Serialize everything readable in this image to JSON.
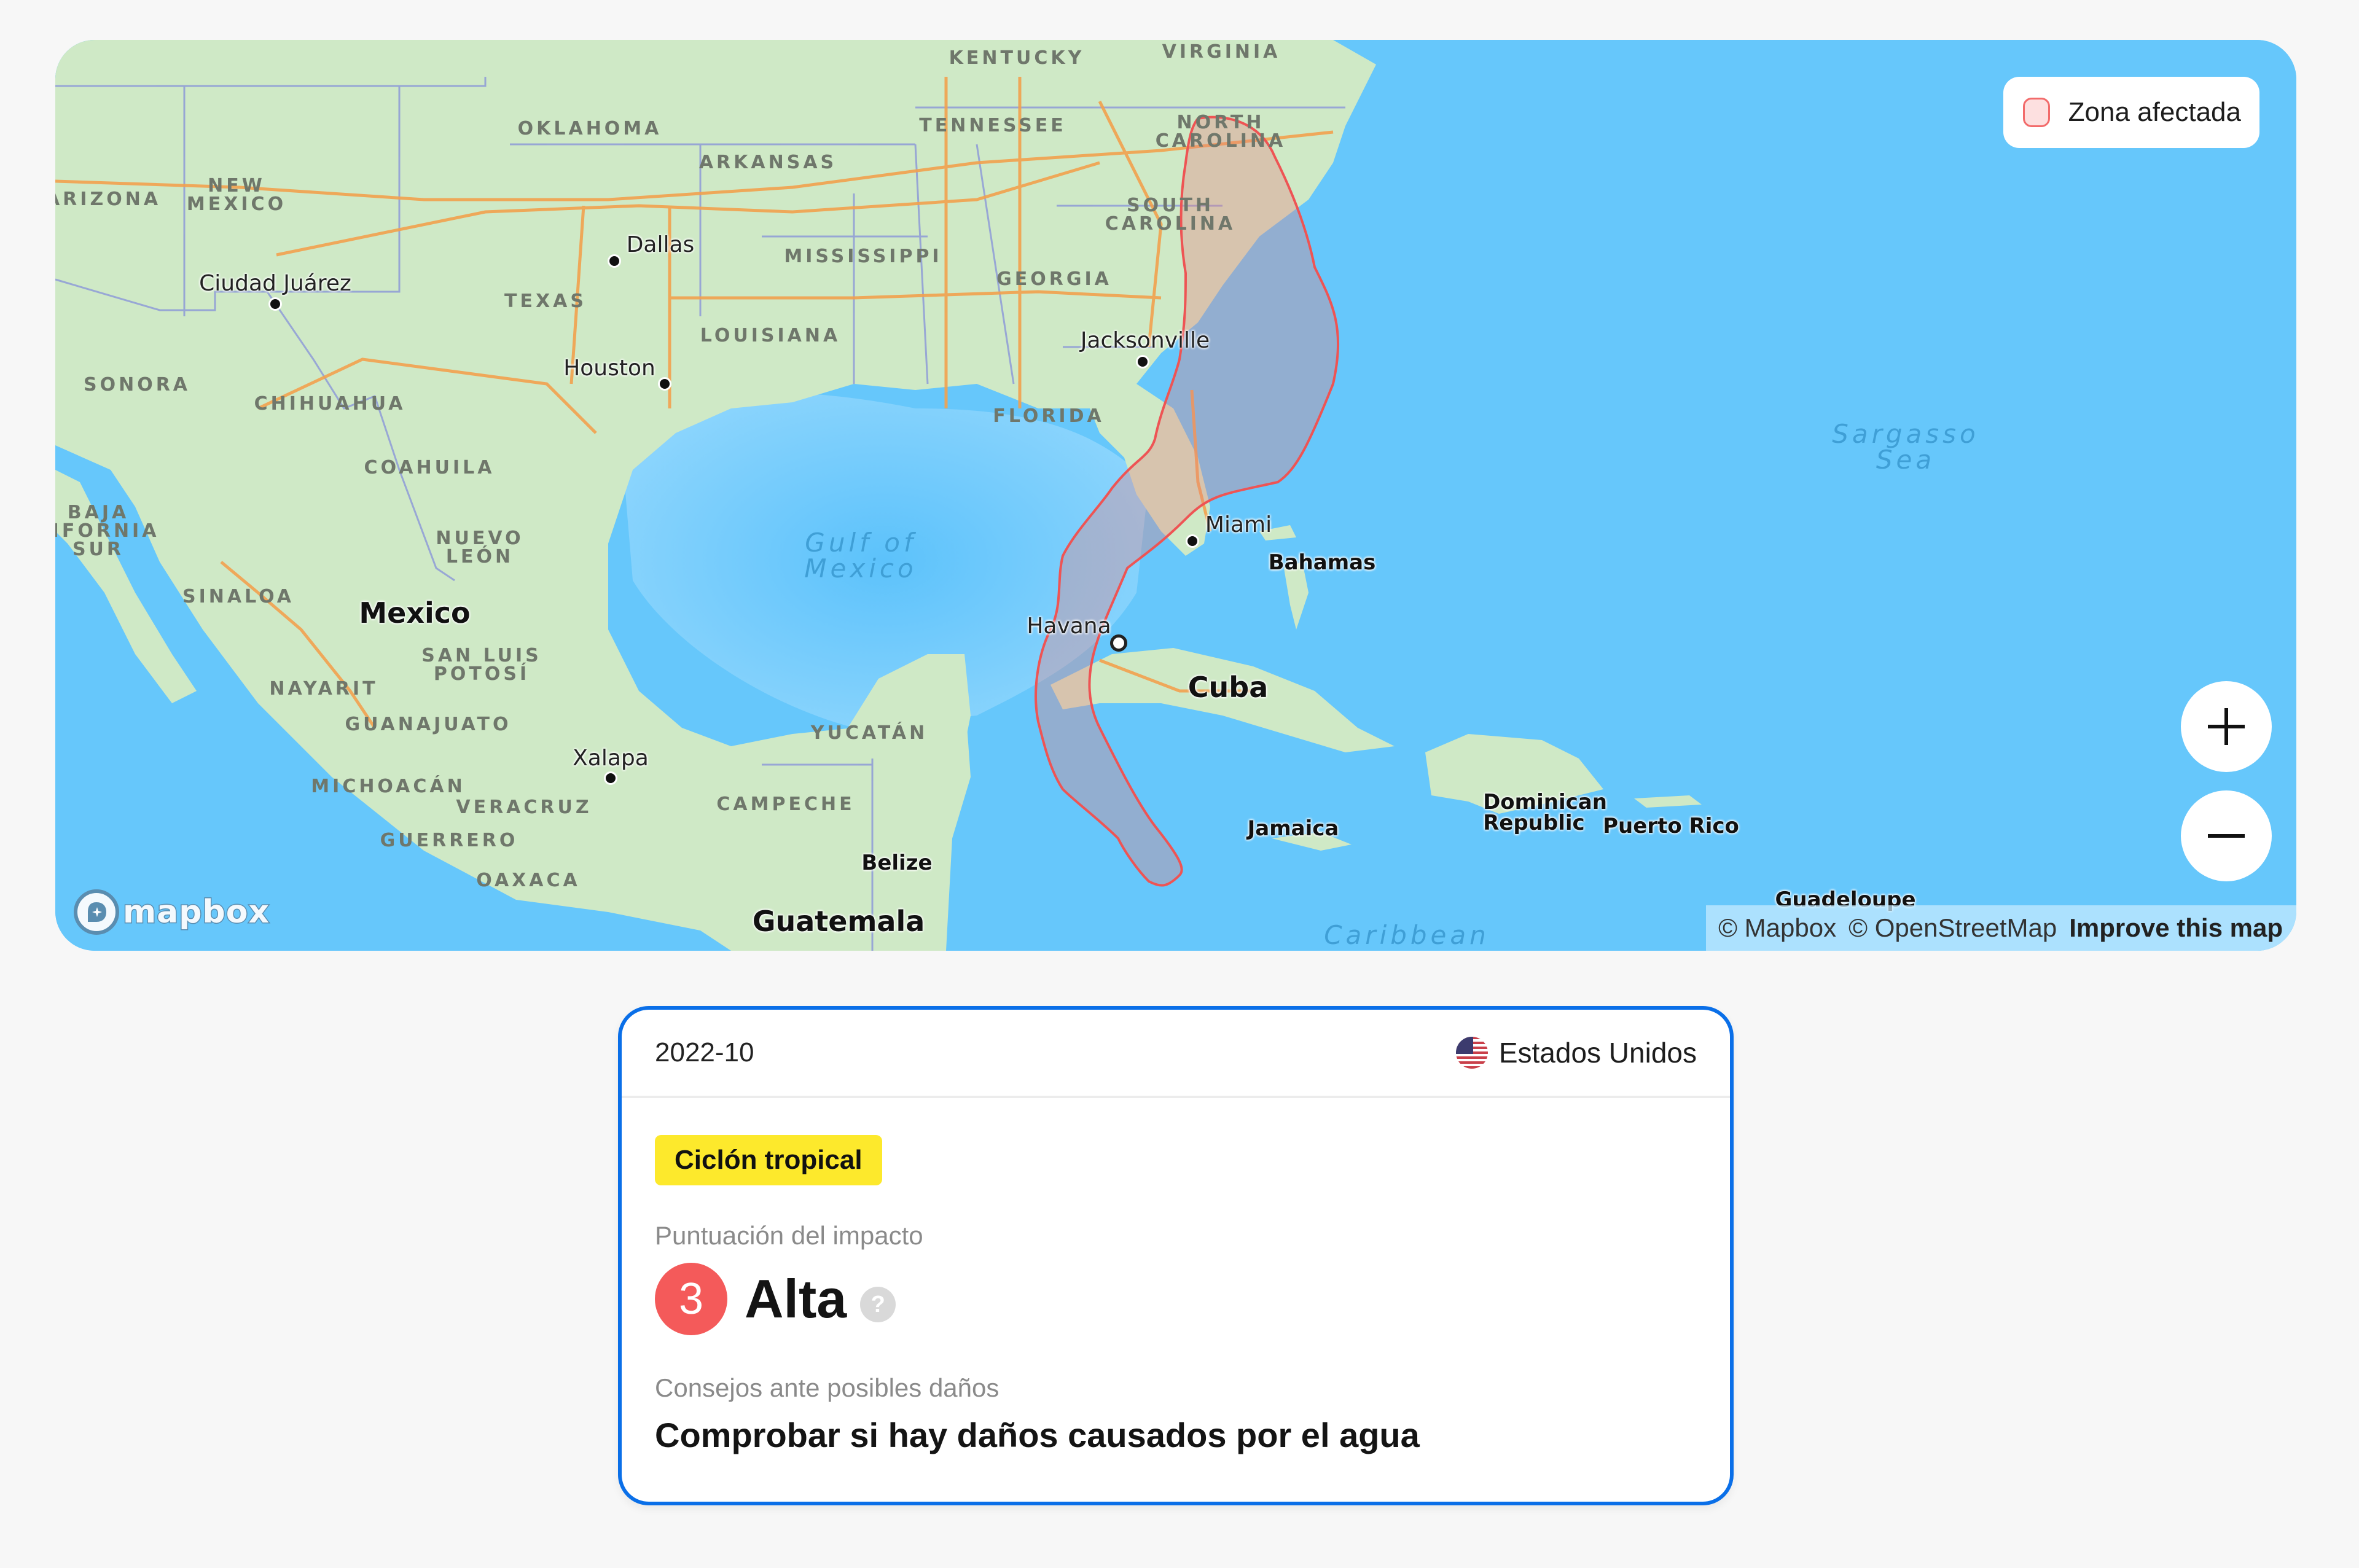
{
  "map": {
    "legend": {
      "label": "Zona afectada",
      "fill_color": "#fde0e0",
      "stroke_color": "#f26b6b"
    },
    "controls": {
      "zoom_in_icon": "plus-icon",
      "zoom_out_icon": "minus-icon"
    },
    "logo": {
      "text": "mapbox"
    },
    "attribution": {
      "mapbox": "© Mapbox",
      "osm": "© OpenStreetMap",
      "improve": "Improve this map"
    },
    "labels": {
      "states": [
        {
          "text": "KENTUCKY"
        },
        {
          "text": "VIRGINIA"
        },
        {
          "text": "OKLAHOMA"
        },
        {
          "text": "ARKANSAS"
        },
        {
          "text": "TENNESSEE"
        },
        {
          "text": "NORTH\nCAROLINA"
        },
        {
          "text": "ARIZONA"
        },
        {
          "text": "NEW\nMEXICO"
        },
        {
          "text": "SOUTH\nCAROLINA"
        },
        {
          "text": "MISSISSIPPI"
        },
        {
          "text": "GEORGIA"
        },
        {
          "text": "TEXAS"
        },
        {
          "text": "LOUISIANA"
        },
        {
          "text": "FLORIDA"
        },
        {
          "text": "SONORA"
        },
        {
          "text": "CHIHUAHUA"
        },
        {
          "text": "COAHUILA"
        },
        {
          "text": "BAJA\nLIFORNIA\nSUR"
        },
        {
          "text": "NUEVO\nLEÓN"
        },
        {
          "text": "SINALOA"
        },
        {
          "text": "SAN LUIS\nPOTOSÍ"
        },
        {
          "text": "NAYARIT"
        },
        {
          "text": "GUANAJUATO"
        },
        {
          "text": "YUCATÁN"
        },
        {
          "text": "MICHOACÁN"
        },
        {
          "text": "VERACRUZ"
        },
        {
          "text": "CAMPECHE"
        },
        {
          "text": "GUERRERO"
        },
        {
          "text": "OAXACA"
        }
      ],
      "cities": [
        {
          "text": "Dallas"
        },
        {
          "text": "Ciudad Juárez"
        },
        {
          "text": "Houston"
        },
        {
          "text": "Jacksonville"
        },
        {
          "text": "Miami"
        },
        {
          "text": "Havana"
        },
        {
          "text": "Xalapa"
        }
      ],
      "countries": [
        {
          "text": "Mexico"
        },
        {
          "text": "Cuba"
        },
        {
          "text": "Bahamas"
        },
        {
          "text": "Jamaica"
        },
        {
          "text": "Dominican\nRepublic"
        },
        {
          "text": "Puerto Rico"
        },
        {
          "text": "Belize"
        },
        {
          "text": "Guatemala"
        },
        {
          "text": "Guadeloupe"
        }
      ],
      "seas": [
        {
          "text": "Gulf of\nMexico"
        },
        {
          "text": "Sargasso\nSea"
        },
        {
          "text": "Caribbean"
        }
      ]
    }
  },
  "event": {
    "date": "2022-10",
    "country": "Estados Unidos",
    "country_flag_icon": "us-flag-icon",
    "type_tag": "Ciclón tropical",
    "type_tag_color": "#fde92c",
    "impact_label": "Puntuación del impacto",
    "impact_score": "3",
    "impact_level": "Alta",
    "impact_color": "#f45a5a",
    "help_icon": "?",
    "advice_label": "Consejos ante posibles daños",
    "advice": "Comprobar si hay daños causados por el agua",
    "accent_color": "#0a6fe8"
  }
}
